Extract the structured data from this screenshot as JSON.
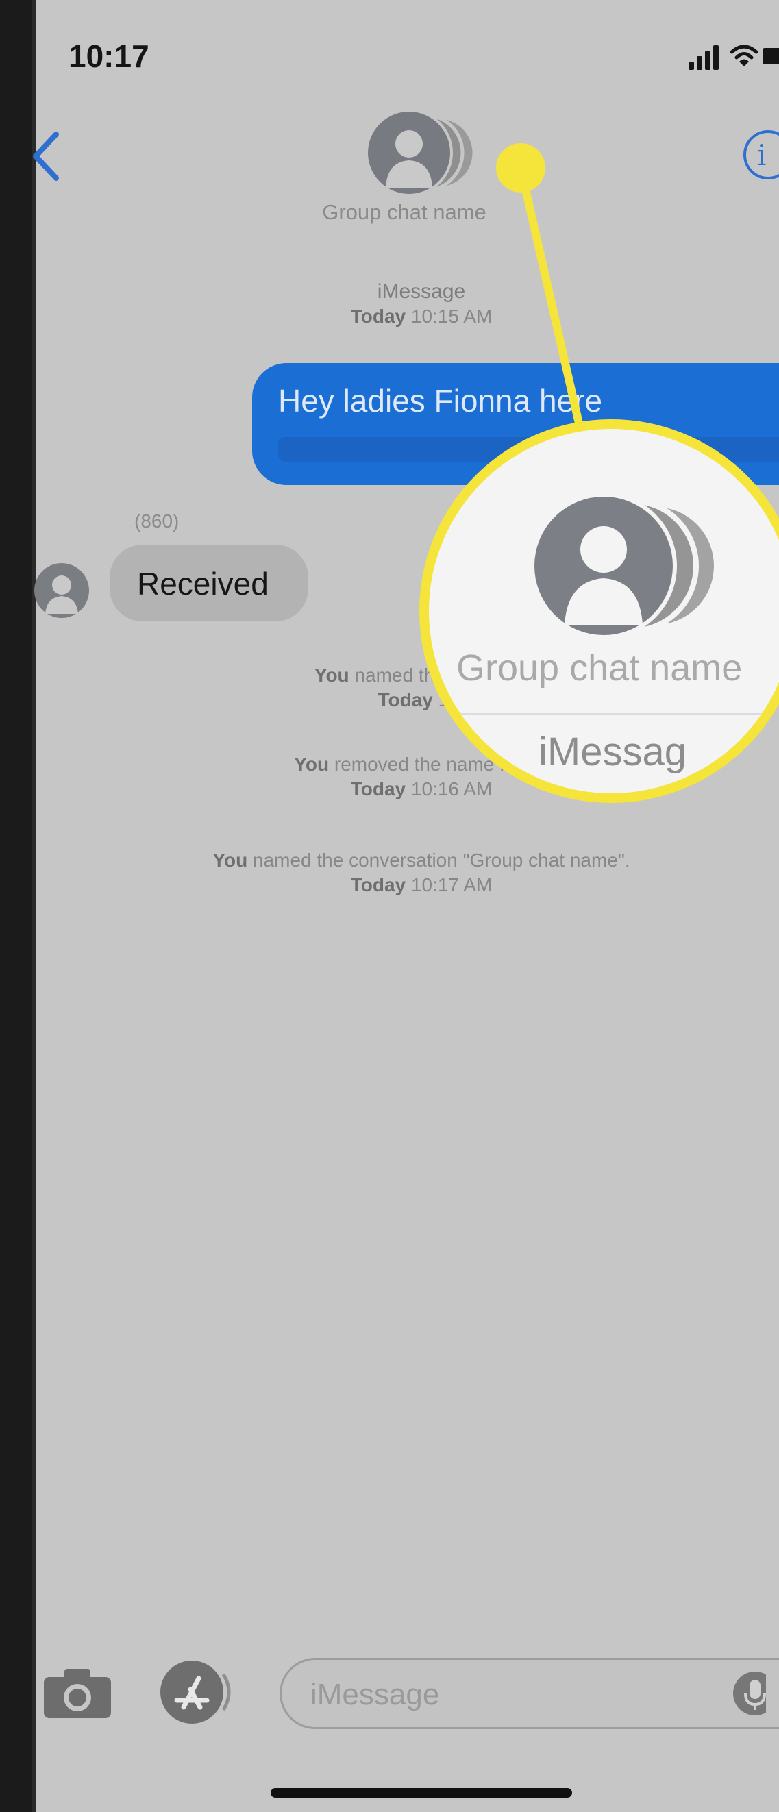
{
  "status_bar": {
    "time": "10:17",
    "icons": [
      "signal-icon",
      "wifi-icon",
      "battery-icon"
    ]
  },
  "header": {
    "back_icon": "chevron-left-icon",
    "info_icon": "info-icon",
    "info_glyph": "i",
    "group_name": "Group chat name",
    "avatar_icon": "group-avatar-icon"
  },
  "thread": {
    "service_label": "iMessage",
    "first_timestamp": {
      "day": "Today",
      "time": "10:15 AM"
    },
    "sent_message": "Hey ladies Fionna here",
    "sender_label": "(860)",
    "received_message": "Received",
    "events": [
      {
        "actor": "You",
        "text": "named the conversa",
        "day": "Today",
        "time": "10:"
      },
      {
        "actor": "You",
        "text": "removed the name from t",
        "day": "Today",
        "time": "10:16 AM"
      },
      {
        "actor": "You",
        "text": "named the conversation \"Group chat name\".",
        "day": "Today",
        "time": "10:17 AM"
      }
    ]
  },
  "magnifier": {
    "group_name": "Group chat name",
    "service_label": "iMessag"
  },
  "input_bar": {
    "placeholder": "iMessage",
    "icons": [
      "camera-icon",
      "app-store-icon",
      "microphone-icon"
    ]
  },
  "colors": {
    "accent": "#2f6fd0",
    "sent_bubble": "#1a6ed4",
    "received_bubble": "#b3b3b3",
    "highlight": "#f5e43a",
    "background": "#c6c6c6"
  }
}
